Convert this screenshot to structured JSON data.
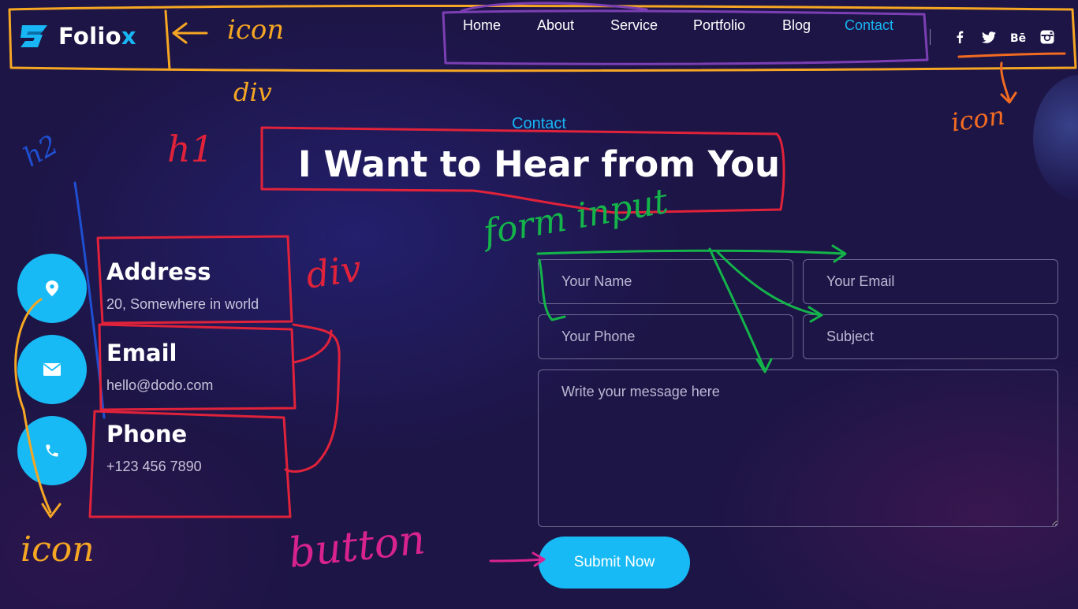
{
  "brand": {
    "name_main": "Folio",
    "name_accent": "x",
    "accent_color": "#18b6f4"
  },
  "nav": {
    "items": [
      {
        "label": "Home"
      },
      {
        "label": "About"
      },
      {
        "label": "Service"
      },
      {
        "label": "Portfolio"
      },
      {
        "label": "Blog"
      },
      {
        "label": "Contact",
        "active": true
      }
    ],
    "social": [
      "facebook-icon",
      "twitter-icon",
      "behance-icon",
      "instagram-icon"
    ]
  },
  "section": {
    "subtitle": "Contact",
    "title": "I Want to Hear from You"
  },
  "contact_info": [
    {
      "icon": "location-pin-icon",
      "title": "Address",
      "text": "20, Somewhere in world"
    },
    {
      "icon": "envelope-icon",
      "title": "Email",
      "text": "hello@dodo.com"
    },
    {
      "icon": "phone-icon",
      "title": "Phone",
      "text": "+123 456 7890"
    }
  ],
  "form": {
    "name_placeholder": "Your Name",
    "email_placeholder": "Your Email",
    "phone_placeholder": "Your Phone",
    "subject_placeholder": "Subject",
    "message_placeholder": "Write your message here",
    "submit_label": "Submit Now"
  },
  "annotations": {
    "icon_top_left": "icon",
    "div_label": "div",
    "icon_top_right": "icon",
    "h2_label": "h2",
    "h1_label": "h1",
    "div_right": "div",
    "form_input": "form input",
    "icon_bottom": "icon",
    "button_label": "button"
  },
  "colors": {
    "background": "#1d1546",
    "accent": "#18b6f4",
    "annotation_orange": "#f5a623",
    "annotation_purple": "#7b3fb3",
    "annotation_red": "#e0223a",
    "annotation_green": "#14b44a",
    "annotation_blue": "#1f4fd1",
    "annotation_pink": "#d8238f",
    "annotation_social_orange": "#f26b21"
  }
}
